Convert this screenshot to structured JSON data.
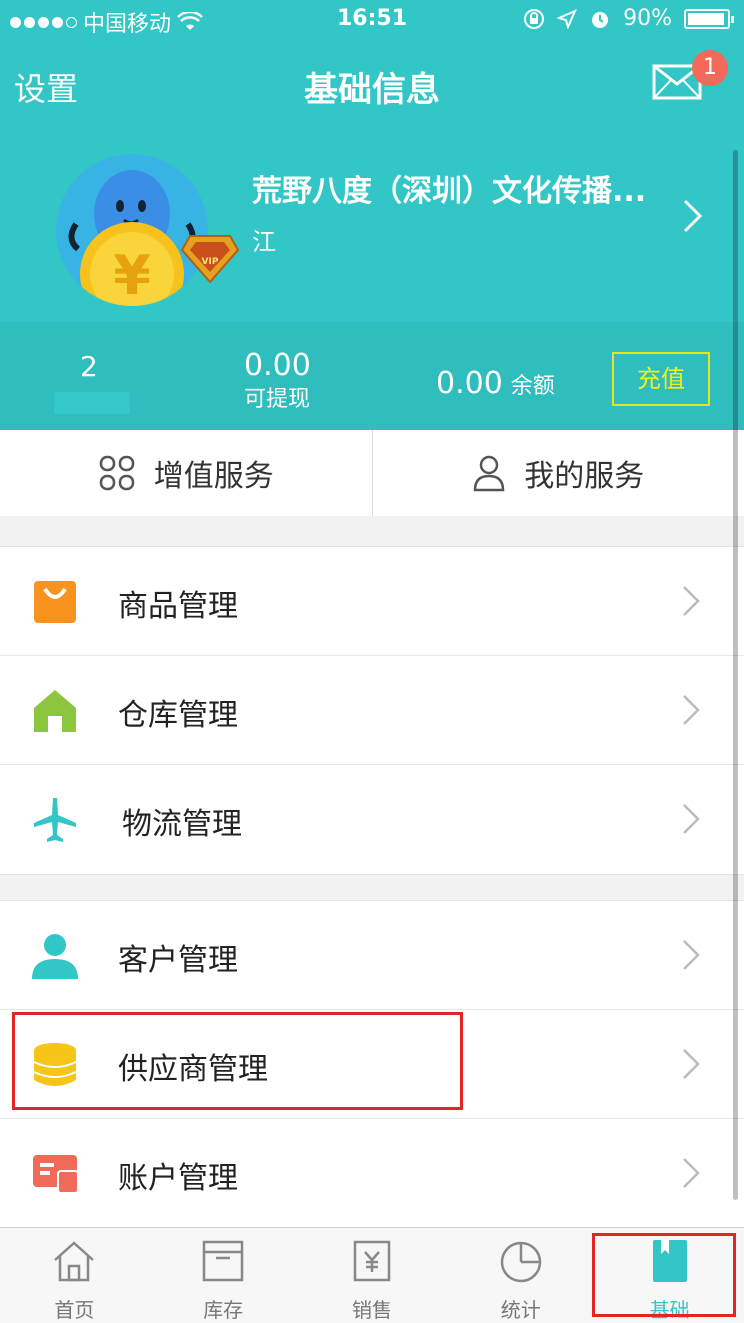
{
  "status_bar": {
    "carrier": "中国移动",
    "time": "16:51",
    "battery": "90%"
  },
  "nav": {
    "settings_label": "设置",
    "title": "基础信息",
    "mail_badge": "1"
  },
  "profile": {
    "company": "荒野八度（深圳）文化传播...",
    "subtitle": "江"
  },
  "stats": {
    "count": "2",
    "withdrawable_value": "0.00",
    "withdrawable_label": "可提现",
    "balance_value": "0.00",
    "balance_label": "余额",
    "recharge_label": "充值"
  },
  "services": {
    "value_added": "增值服务",
    "my_services": "我的服务"
  },
  "menu": {
    "group1": [
      {
        "label": "商品管理",
        "icon": "shopping-bag-icon"
      },
      {
        "label": "仓库管理",
        "icon": "warehouse-icon"
      },
      {
        "label": "物流管理",
        "icon": "airplane-icon"
      }
    ],
    "group2": [
      {
        "label": "客户管理",
        "icon": "customer-icon"
      },
      {
        "label": "供应商管理",
        "icon": "supplier-icon"
      },
      {
        "label": "账户管理",
        "icon": "account-icon"
      }
    ]
  },
  "tabs": [
    {
      "label": "首页",
      "icon": "home-icon"
    },
    {
      "label": "库存",
      "icon": "inventory-icon"
    },
    {
      "label": "销售",
      "icon": "sales-icon"
    },
    {
      "label": "统计",
      "icon": "statistics-icon"
    },
    {
      "label": "基础",
      "icon": "basic-icon"
    }
  ],
  "colors": {
    "primary": "#33c6c6",
    "highlight": "#e02626",
    "recharge": "#e6e61c"
  }
}
